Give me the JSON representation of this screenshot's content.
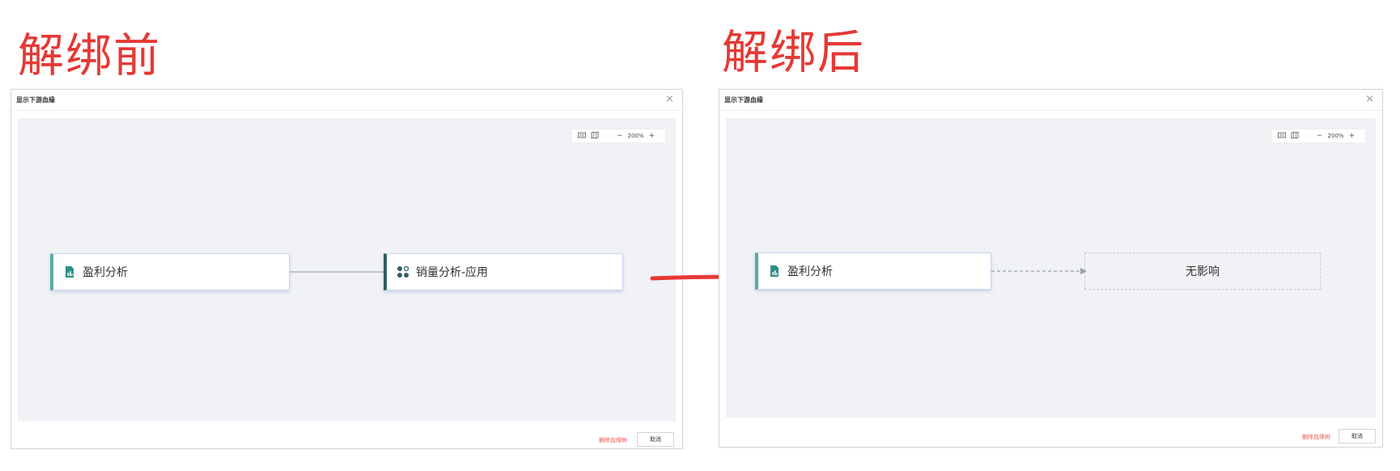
{
  "before": {
    "heading": "解绑前",
    "dialog_title": "显示下游血缘",
    "close_icon": "×",
    "zoom": "200%",
    "toolbar_icons": [
      "keyboard-icon",
      "map-icon",
      "zoom-out-icon",
      "zoom-in-icon"
    ],
    "source_node": {
      "label": "盈利分析",
      "icon": "report-chart-icon"
    },
    "target_node": {
      "label": "销量分析-应用",
      "icon": "app-grid-icon"
    },
    "footer": {
      "delete_link": "删除血缘树",
      "cancel": "取消"
    }
  },
  "after": {
    "heading": "解绑后",
    "dialog_title": "显示下游血缘",
    "close_icon": "×",
    "zoom": "200%",
    "toolbar_icons": [
      "keyboard-icon",
      "map-icon",
      "zoom-out-icon",
      "zoom-in-icon"
    ],
    "source_node": {
      "label": "盈利分析",
      "icon": "report-chart-icon"
    },
    "empty_node": {
      "label": "无影响"
    },
    "footer": {
      "delete_link": "删除血缘树",
      "cancel": "取消"
    }
  },
  "colors": {
    "heading": "#e53935",
    "arrow": "#e53935",
    "canvas": "#f1f2f6",
    "report_accent": "#5aa9a6",
    "app_accent": "#2f5e62"
  }
}
